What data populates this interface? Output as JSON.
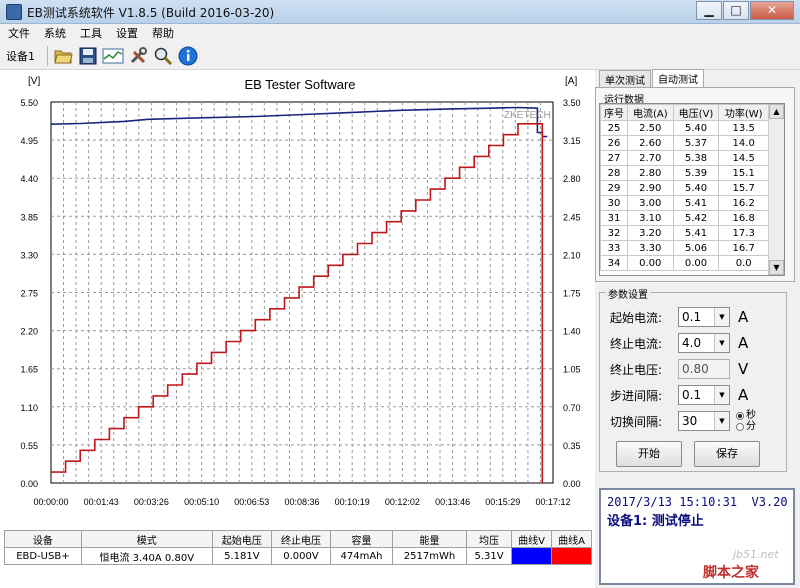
{
  "window": {
    "title": "EB测试系统软件 V1.8.5 (Build 2016-03-20)",
    "min": "▁",
    "max": "□",
    "close": "✕"
  },
  "menu": [
    "文件",
    "系统",
    "工具",
    "设置",
    "帮助"
  ],
  "toolbar": {
    "device": "设备1"
  },
  "chart_data": {
    "type": "line",
    "title": "EB Tester Software",
    "watermark": "ZKETECH",
    "ylabel_left": "[V]",
    "ylabel_right": "[A]",
    "ylim_left": [
      0.0,
      5.5
    ],
    "ylim_right": [
      0.0,
      3.5
    ],
    "yticks_left": [
      "5.50",
      "4.95",
      "4.40",
      "3.85",
      "3.30",
      "2.75",
      "2.20",
      "1.65",
      "1.10",
      "0.55",
      "0.00"
    ],
    "yticks_right": [
      "3.50",
      "3.15",
      "2.80",
      "2.45",
      "2.10",
      "1.75",
      "1.40",
      "1.05",
      "0.70",
      "0.35",
      "0.00"
    ],
    "xticks": [
      "00:00:00",
      "00:01:43",
      "00:03:26",
      "00:05:10",
      "00:06:53",
      "00:08:36",
      "00:10:19",
      "00:12:02",
      "00:13:46",
      "00:15:29",
      "00:17:12"
    ],
    "xlim_seconds": [
      0,
      1032
    ],
    "series": [
      {
        "axis": "left",
        "color": "#1a237e",
        "points": [
          [
            0,
            5.18
          ],
          [
            60,
            5.19
          ],
          [
            150,
            5.22
          ],
          [
            200,
            5.25
          ],
          [
            300,
            5.27
          ],
          [
            420,
            5.29
          ],
          [
            520,
            5.32
          ],
          [
            620,
            5.35
          ],
          [
            720,
            5.38
          ],
          [
            820,
            5.4
          ],
          [
            900,
            5.41
          ],
          [
            960,
            5.42
          ],
          [
            1000,
            5.41
          ],
          [
            1000,
            5.06
          ],
          [
            1010,
            5.06
          ],
          [
            1010,
            5.0
          ],
          [
            1020,
            5.0
          ]
        ]
      },
      {
        "axis": "right",
        "color": "#c0171b",
        "step_start": 0.1,
        "step_size": 0.1,
        "step_seconds": 30,
        "steps": 33,
        "end_seconds": 1010
      }
    ]
  },
  "bottom_table": {
    "headers": [
      "设备",
      "模式",
      "起始电压",
      "终止电压",
      "容量",
      "能量",
      "均压",
      "曲线V",
      "曲线A"
    ],
    "row": [
      "EBD-USB+",
      "恒电流  3.40A  0.80V",
      "5.181V",
      "0.000V",
      "474mAh",
      "2517mWh",
      "5.31V",
      "",
      ""
    ],
    "curve_v_color": "#0000ff",
    "curve_a_color": "#ff0000"
  },
  "tabs": [
    "单次测试",
    "自动测试"
  ],
  "realtime": {
    "title": "运行数据",
    "headers": [
      "序号",
      "电流(A)",
      "电压(V)",
      "功率(W)"
    ],
    "rows": [
      [
        "25",
        "2.50",
        "5.40",
        "13.5"
      ],
      [
        "26",
        "2.60",
        "5.37",
        "14.0"
      ],
      [
        "27",
        "2.70",
        "5.38",
        "14.5"
      ],
      [
        "28",
        "2.80",
        "5.39",
        "15.1"
      ],
      [
        "29",
        "2.90",
        "5.40",
        "15.7"
      ],
      [
        "30",
        "3.00",
        "5.41",
        "16.2"
      ],
      [
        "31",
        "3.10",
        "5.42",
        "16.8"
      ],
      [
        "32",
        "3.20",
        "5.41",
        "17.3"
      ],
      [
        "33",
        "3.30",
        "5.06",
        "16.7"
      ],
      [
        "34",
        "0.00",
        "0.00",
        "0.0"
      ]
    ]
  },
  "params": {
    "title": "参数设置",
    "start_current": {
      "label": "起始电流:",
      "value": "0.1",
      "unit": "A"
    },
    "end_current": {
      "label": "终止电流:",
      "value": "4.0",
      "unit": "A"
    },
    "end_voltage": {
      "label": "终止电压:",
      "value": "0.80",
      "unit": "V"
    },
    "step": {
      "label": "步进间隔:",
      "value": "0.1",
      "unit": "A"
    },
    "interval": {
      "label": "切换间隔:",
      "value": "30",
      "unit_sec": "秒",
      "unit_min": "分"
    },
    "start_button": "开始",
    "save_button": "保存"
  },
  "status": {
    "datetime": "2017/3/13 15:10:31",
    "version": "V3.20",
    "message": "设备1: 测试停止",
    "watermark_site": "jb51.net",
    "watermark_name": "脚本之家"
  }
}
